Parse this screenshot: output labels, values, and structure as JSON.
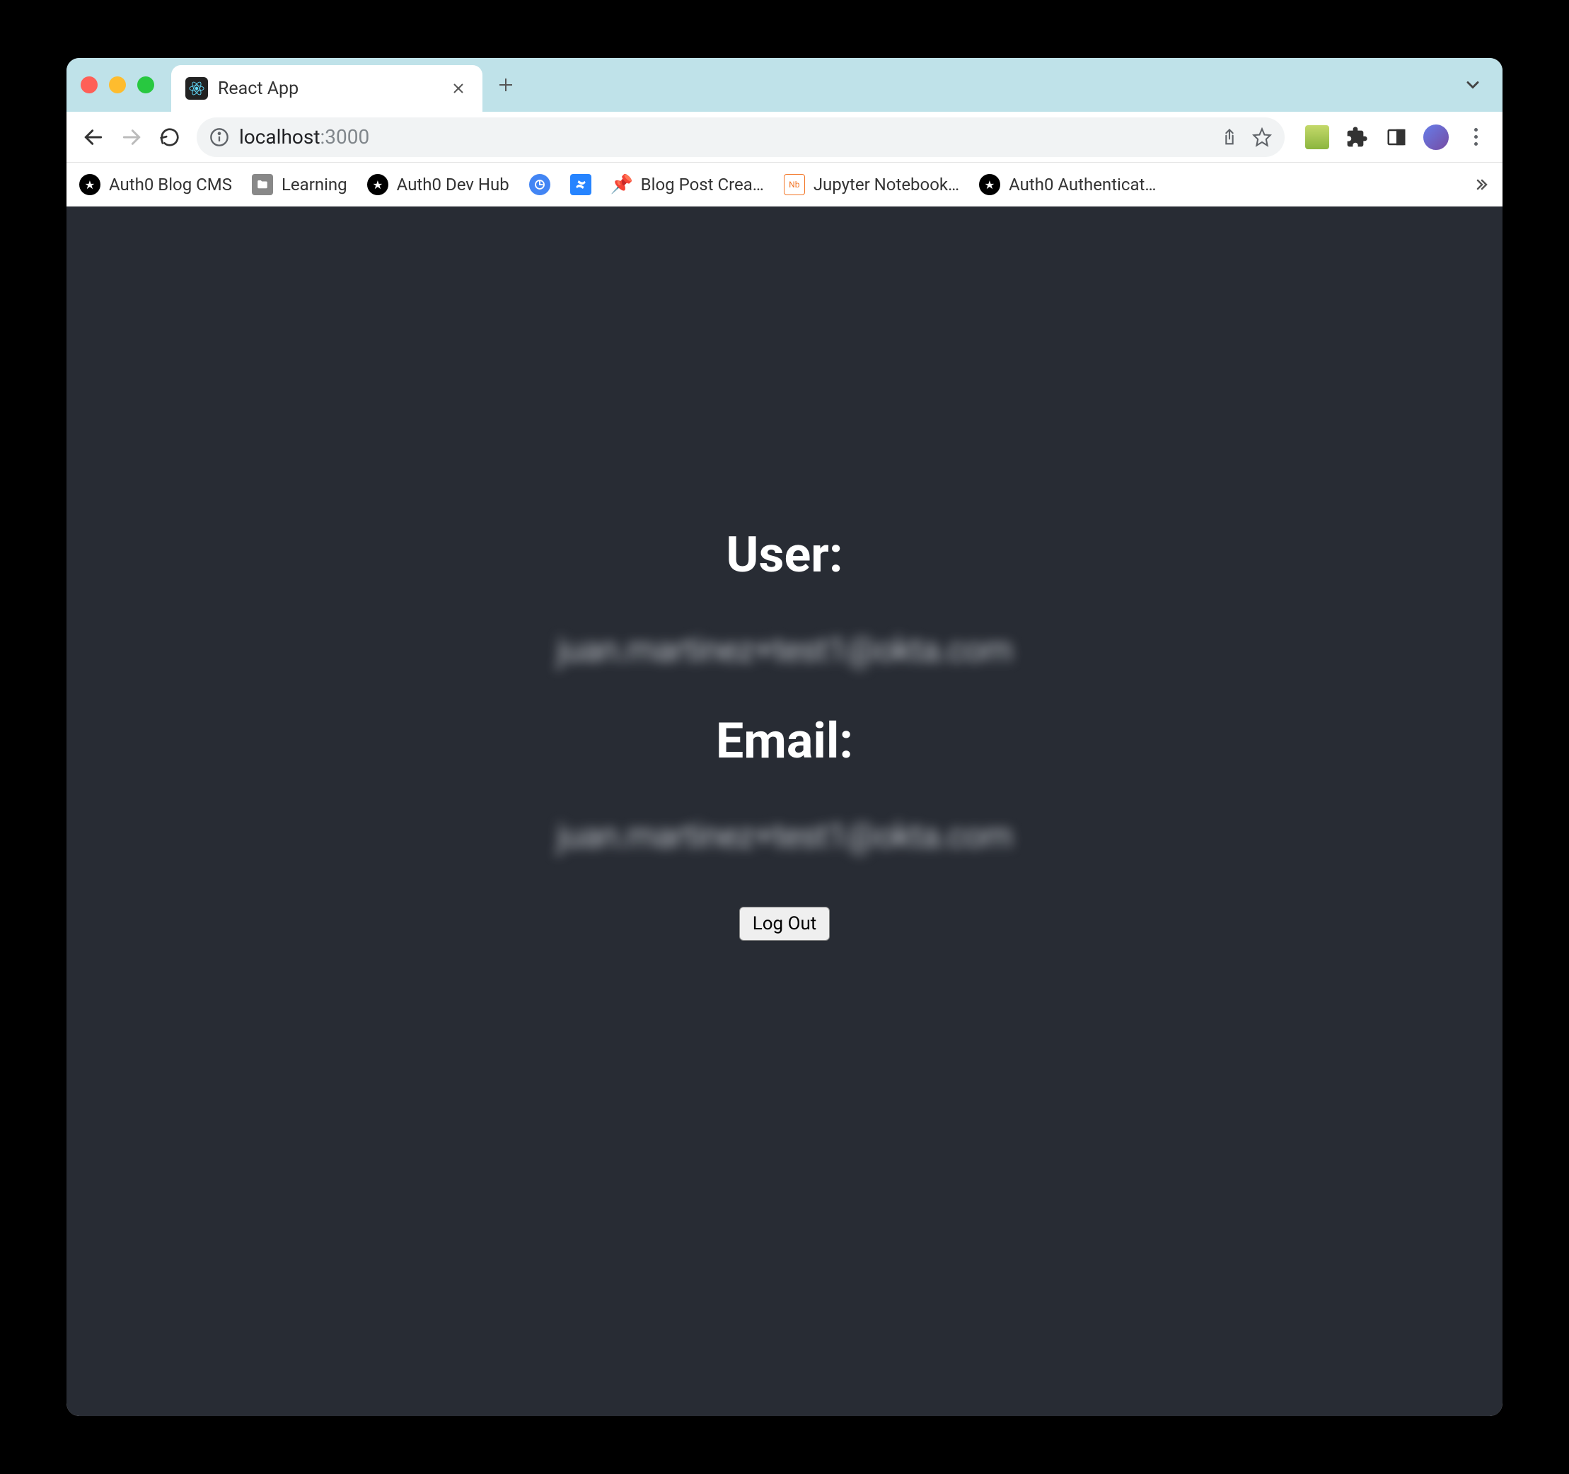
{
  "tab": {
    "title": "React App"
  },
  "url": {
    "host": "localhost",
    "port": ":3000"
  },
  "bookmarks": [
    {
      "label": "Auth0 Blog CMS",
      "icon": "auth0"
    },
    {
      "label": "Learning",
      "icon": "folder"
    },
    {
      "label": "Auth0 Dev Hub",
      "icon": "auth0"
    },
    {
      "label": "",
      "icon": "blue"
    },
    {
      "label": "",
      "icon": "confluence"
    },
    {
      "label": "Blog Post Crea…",
      "icon": "pin"
    },
    {
      "label": "Jupyter Notebook…",
      "icon": "nb"
    },
    {
      "label": "Auth0 Authenticat…",
      "icon": "auth0"
    }
  ],
  "page": {
    "user_label": "User:",
    "user_value": "juan.martinez+test1@okta.com",
    "email_label": "Email:",
    "email_value": "juan.martinez+test1@okta.com",
    "logout_label": "Log Out"
  }
}
